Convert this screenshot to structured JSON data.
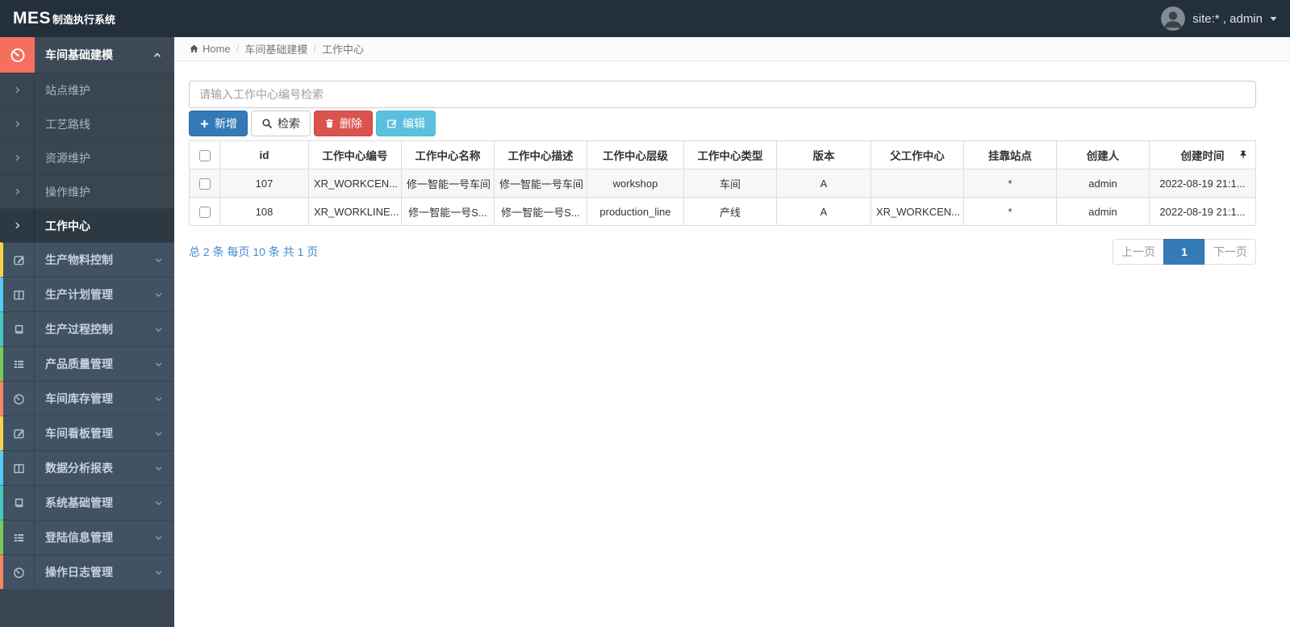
{
  "navbar": {
    "logo_primary": "MES",
    "logo_secondary": "制造执行系统",
    "user_label": "site:* , admin"
  },
  "sidebar": {
    "group": {
      "label": "车间基础建模",
      "icon": "gauge-icon"
    },
    "submenu": [
      {
        "label": "站点维护"
      },
      {
        "label": "工艺路线"
      },
      {
        "label": "资源维护"
      },
      {
        "label": "操作维护"
      },
      {
        "label": "工作中心",
        "active": true
      }
    ],
    "items": [
      {
        "label": "生产物料控制",
        "icon": "pencil-square-icon",
        "accent": "#f8d347"
      },
      {
        "label": "生产计划管理",
        "icon": "columns-icon",
        "accent": "#58c9f3"
      },
      {
        "label": "生产过程控制",
        "icon": "book-icon",
        "accent": "#41cac0"
      },
      {
        "label": "产品质量管理",
        "icon": "tasks-icon",
        "accent": "#78cd51"
      },
      {
        "label": "车间库存管理",
        "icon": "gauge-icon",
        "accent": "#fa8564"
      },
      {
        "label": "车间看板管理",
        "icon": "pencil-square-icon",
        "accent": "#f8d347"
      },
      {
        "label": "数据分析报表",
        "icon": "columns-icon",
        "accent": "#58c9f3"
      },
      {
        "label": "系统基础管理",
        "icon": "book-icon",
        "accent": "#41cac0"
      },
      {
        "label": "登陆信息管理",
        "icon": "tasks-icon",
        "accent": "#78cd51"
      },
      {
        "label": "操作日志管理",
        "icon": "gauge-icon",
        "accent": "#fa8564"
      }
    ]
  },
  "breadcrumb": {
    "home": "Home",
    "section": "车间基础建模",
    "current": "工作中心"
  },
  "toolbar": {
    "search_placeholder": "请输入工作中心编号检索",
    "add_label": "新增",
    "search_label": "检索",
    "delete_label": "删除",
    "edit_label": "编辑"
  },
  "table": {
    "headers": [
      "id",
      "工作中心编号",
      "工作中心名称",
      "工作中心描述",
      "工作中心层级",
      "工作中心类型",
      "版本",
      "父工作中心",
      "挂靠站点",
      "创建人",
      "创建时间"
    ],
    "rows": [
      {
        "cells": [
          "107",
          "XR_WORKCEN...",
          "修一智能一号车间",
          "修一智能一号车间",
          "workshop",
          "车间",
          "A",
          "",
          "*",
          "admin",
          "2022-08-19 21:1..."
        ]
      },
      {
        "cells": [
          "108",
          "XR_WORKLINE...",
          "修一智能一号S...",
          "修一智能一号S...",
          "production_line",
          "产线",
          "A",
          "XR_WORKCEN...",
          "*",
          "admin",
          "2022-08-19 21:1..."
        ]
      }
    ]
  },
  "pagination": {
    "summary": "总 2 条 每页 10 条 共 1 页",
    "prev": "上一页",
    "page": "1",
    "next": "下一页"
  },
  "colors": {
    "navbar_bg": "#242f3c",
    "sidebar_item_bg": "#415263",
    "submenu_bg": "#39454f",
    "submenu_active_bg": "#2c3842",
    "group_icon_bg": "#f4705c",
    "primary": "#337ab7",
    "danger": "#d9534f",
    "info": "#5bc0de",
    "link": "#428bca",
    "accent_yellow": "#f8d347",
    "accent_blue": "#58c9f3",
    "accent_teal": "#41cac0",
    "accent_green": "#78cd51",
    "accent_red": "#fa8564"
  }
}
